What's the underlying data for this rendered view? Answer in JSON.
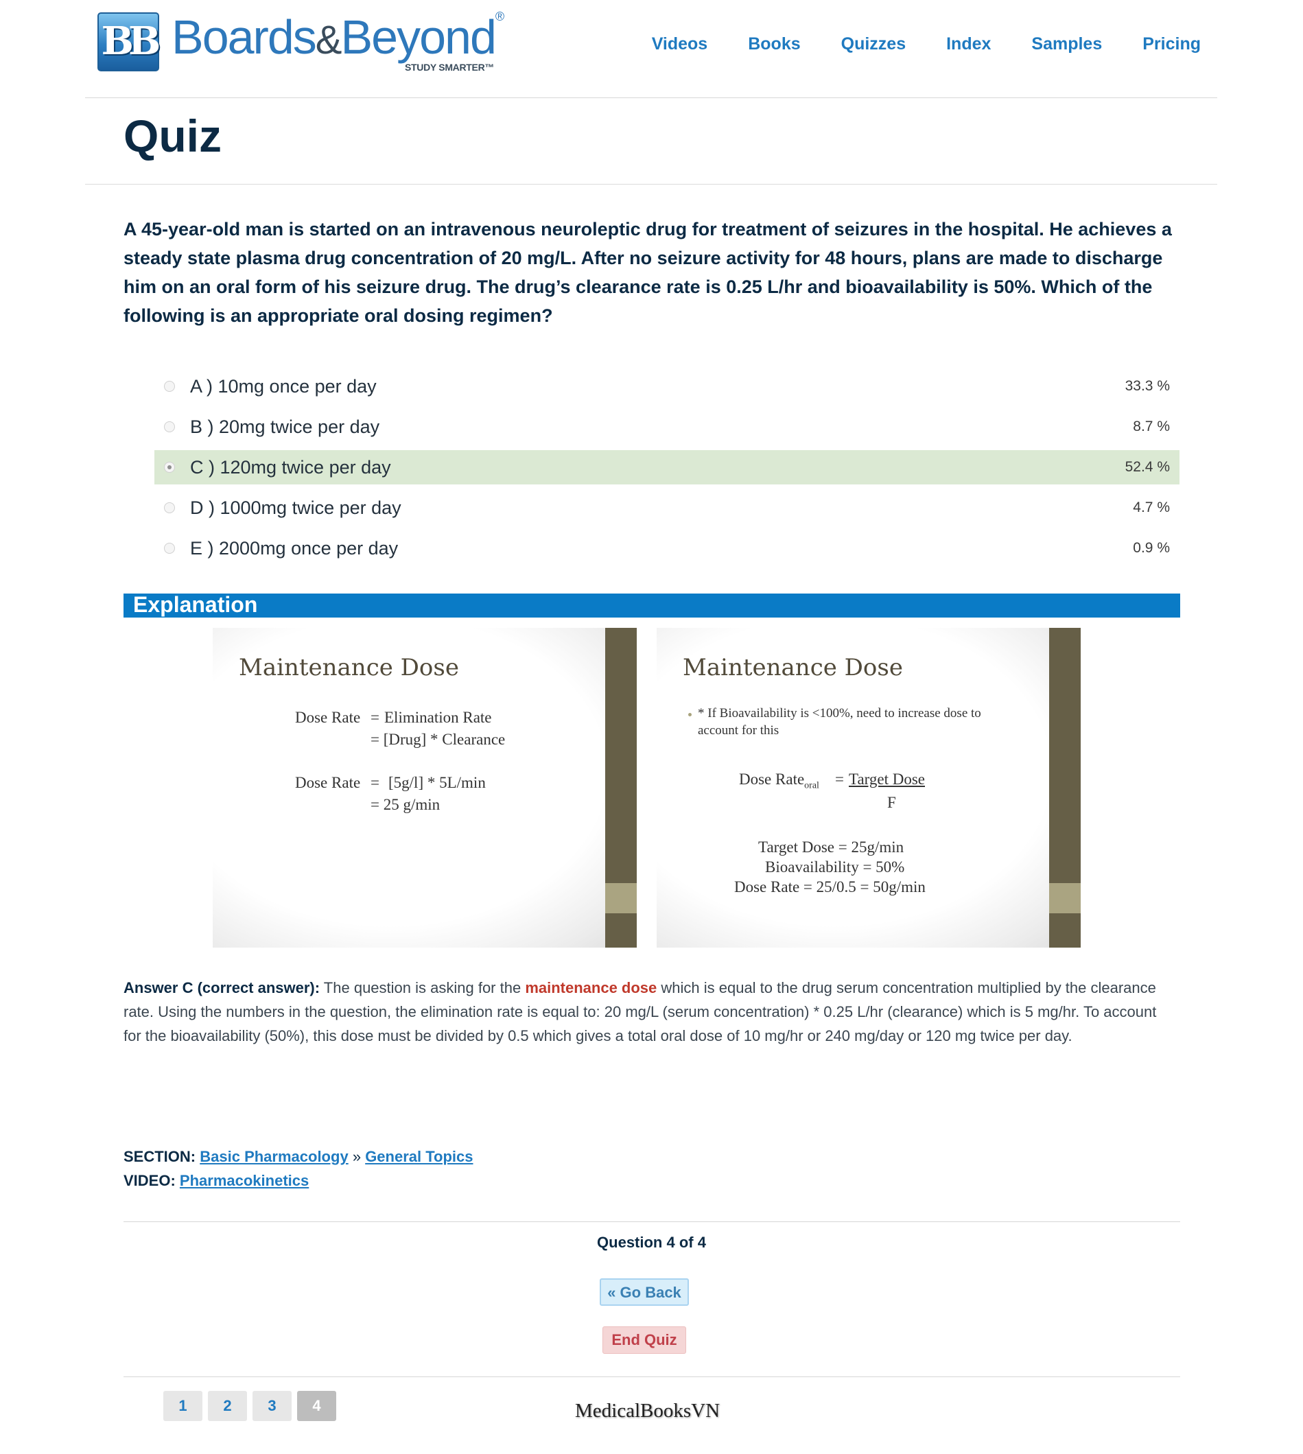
{
  "brand": {
    "mark": "BB",
    "name_part1": "Boards",
    "amp": "&",
    "name_part2": "Beyond",
    "registered": "®",
    "tagline": "STUDY SMARTER™"
  },
  "nav": {
    "videos": "Videos",
    "books": "Books",
    "quizzes": "Quizzes",
    "index": "Index",
    "samples": "Samples",
    "pricing": "Pricing"
  },
  "page_title": "Quiz",
  "question": "A 45-year-old man is started on an intravenous neuroleptic drug for treatment of seizures in the hospital. He achieves a steady state plasma drug concentration of 20 mg/L. After no seizure activity for 48 hours, plans are made to discharge him on an oral form of his seizure drug. The drug’s clearance rate is 0.25 L/hr and bioavailability is 50%. Which of the following is an appropriate oral dosing regimen?",
  "options": [
    {
      "label": "A ) 10mg once per day",
      "percent": "33.3 %"
    },
    {
      "label": "B ) 20mg twice per day",
      "percent": "8.7 %"
    },
    {
      "label": "C ) 120mg twice per day",
      "percent": "52.4 %"
    },
    {
      "label": "D ) 1000mg twice per day",
      "percent": "4.7 %"
    },
    {
      "label": "E ) 2000mg once per day",
      "percent": "0.9 %"
    }
  ],
  "selected_option": "C",
  "correct_color": "#dbe9d3",
  "explanation_heading": "Explanation",
  "slide1": {
    "title": "Maintenance Dose",
    "l1_lhs": "Dose Rate",
    "l1_eq": "=",
    "l1_rhs": "Elimination Rate",
    "l2": "= [Drug] * Clearance",
    "l3_lhs": "Dose Rate",
    "l3_eq": "=",
    "l3_rhs": "[5g/l] * 5L/min",
    "l4": "= 25 g/min"
  },
  "slide2": {
    "title": "Maintenance Dose",
    "bullet_line1": "* If Bioavailability is <100%, need to increase dose to",
    "bullet_line2": "account for this",
    "formula_lhs": "Dose Rate",
    "formula_sub": "oral",
    "formula_eq": "=",
    "formula_num": "Target Dose",
    "formula_den": "F",
    "calc1": "Target Dose =  25g/min",
    "calc2": "Bioavailability = 50%",
    "calc3": "Dose Rate = 25/0.5 = 50g/min"
  },
  "answer": {
    "label": "Answer C (correct answer):",
    "text1": " The question is asking for the ",
    "highlight": "maintenance dose",
    "text2": " which is equal to the drug serum concentration multiplied by the clearance rate. Using the numbers in the question, the elimination rate is equal to: 20 mg/L (serum concentration) * 0.25 L/hr (clearance) which is 5 mg/hr. To account for the bioavailability (50%), this dose must be divided by 0.5 which gives a total oral dose of 10 mg/hr or 240 mg/day or 120 mg twice per day."
  },
  "section": {
    "label": "SECTION:",
    "link1": "Basic Pharmacology",
    "separator": "»",
    "link2": "General Topics"
  },
  "video": {
    "label": "VIDEO:",
    "link": "Pharmacokinetics"
  },
  "question_counter": "Question 4 of 4",
  "go_back": "« Go Back",
  "end_quiz": "End Quiz",
  "pages": [
    "1",
    "2",
    "3",
    "4"
  ],
  "current_page": "4",
  "watermark": "MedicalBooksVN"
}
